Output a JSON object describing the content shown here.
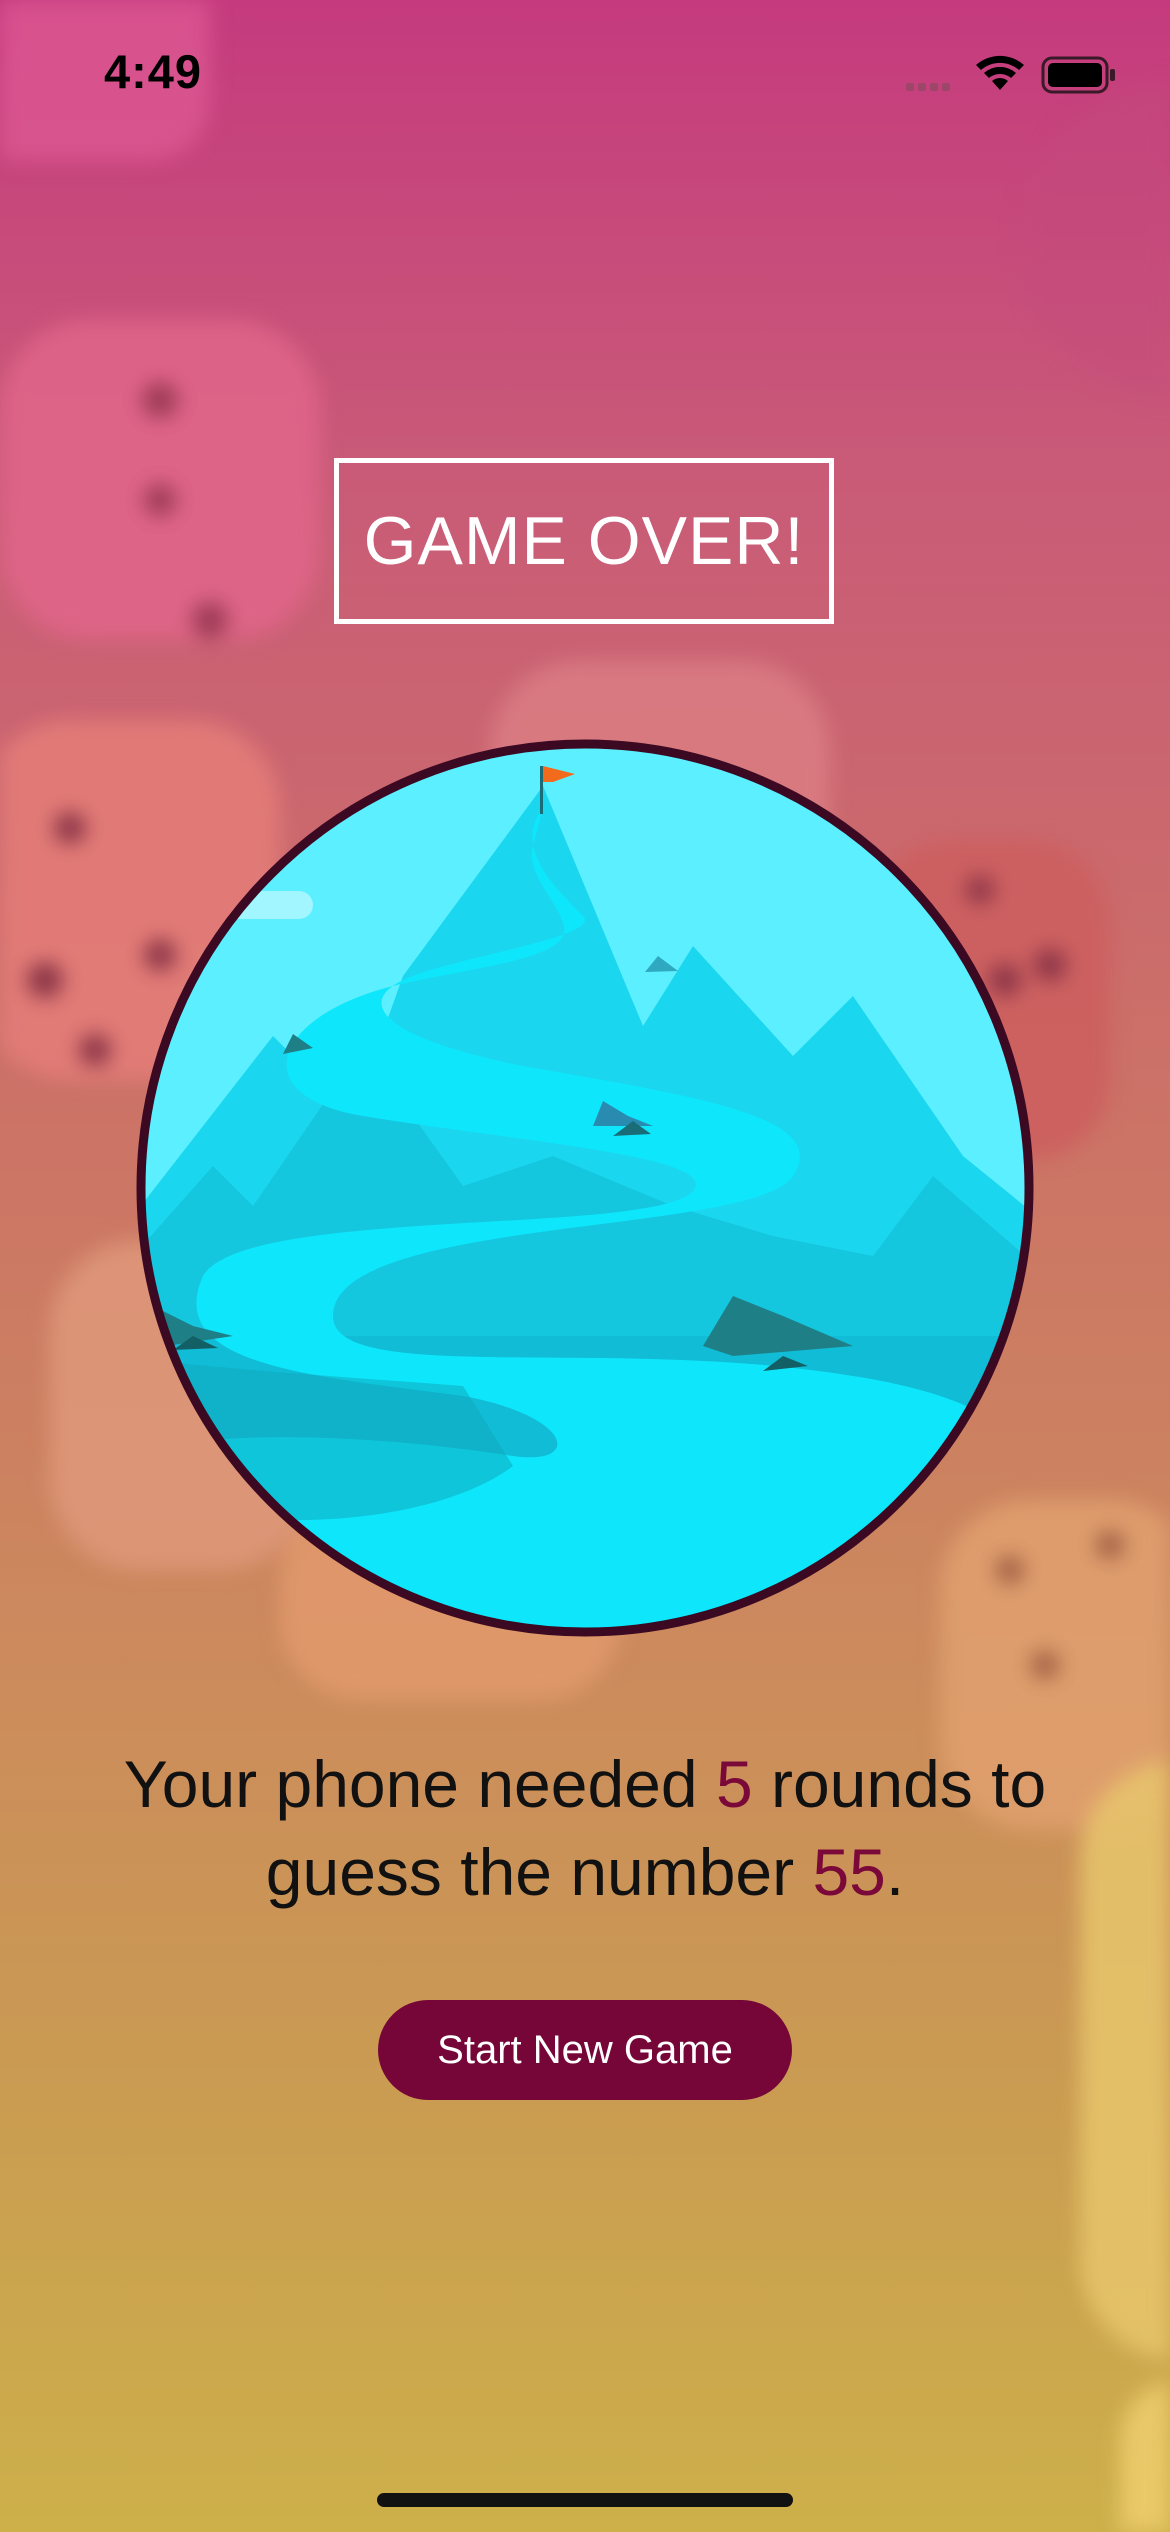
{
  "status_bar": {
    "time": "4:49",
    "icons": [
      "cellular-signal-icon",
      "wifi-icon",
      "battery-icon"
    ]
  },
  "screen": {
    "title": "GAME OVER!",
    "message": {
      "part1": "Your phone needed ",
      "rounds": "5",
      "part2": " rounds to guess the number ",
      "number": "55",
      "part3": "."
    },
    "start_button_label": "Start New Game"
  },
  "colors": {
    "accent": "#760638",
    "highlight_text": "#7a0839",
    "gradient_top": "#c53a7e",
    "gradient_bottom": "#cdb04a",
    "circle_border": "#3b0a22",
    "sky": "#5cefff"
  },
  "background": {
    "decoration": "blurred-dice"
  }
}
